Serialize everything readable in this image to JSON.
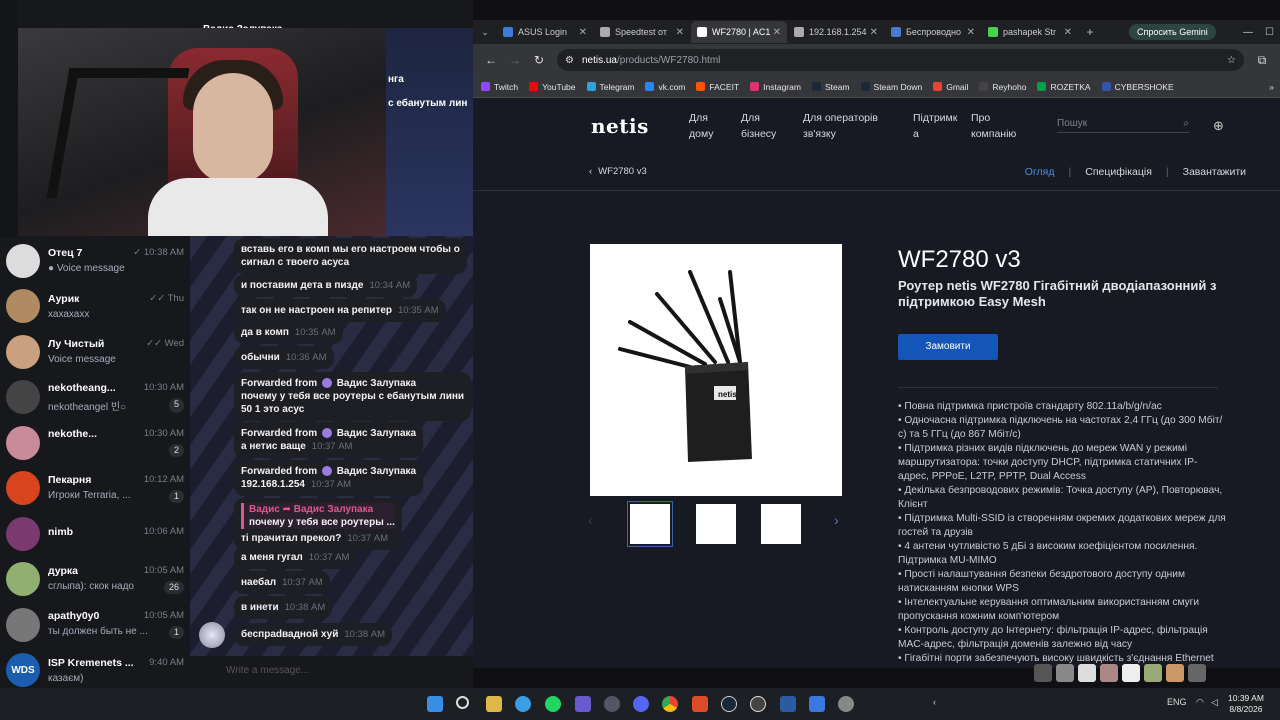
{
  "telegram": {
    "header_partial": "Вадис Залупака",
    "convo_top_lines": [
      "нга",
      "с ебанутым лин"
    ],
    "chats": [
      {
        "name": "Отец 7",
        "time": "10:38 AM",
        "preview": "● Voice message",
        "badge": "",
        "color": "#dcdcdc",
        "initial": "",
        "checks": "✓"
      },
      {
        "name": "Аурик",
        "time": "Thu",
        "preview": "хахахахх",
        "badge": "",
        "color": "#b08a60",
        "initial": "",
        "checks": "✓✓"
      },
      {
        "name": "Лу Чистый",
        "time": "Wed",
        "preview": "Voice message",
        "badge": "",
        "color": "#c9a080",
        "initial": "",
        "checks": "✓✓"
      },
      {
        "name": "nekotheang...",
        "time": "10:30 AM",
        "preview": "nekotheangel 빈○",
        "badge": "5",
        "color": "#444",
        "initial": "",
        "checks": ""
      },
      {
        "name": "nekothe...",
        "time": "10:30 AM",
        "preview": "",
        "badge": "2",
        "color": "#c98a9a",
        "initial": "",
        "checks": ""
      },
      {
        "name": "Пекарня",
        "time": "10:12 AM",
        "preview": "Игроки Terraria, ...",
        "badge": "1",
        "color": "#d8441e",
        "initial": "",
        "checks": ""
      },
      {
        "name": "nimb",
        "time": "10:06 AM",
        "preview": "",
        "badge": "",
        "color": "#7a3a70",
        "initial": "",
        "checks": ""
      },
      {
        "name": "дурка",
        "time": "10:05 AM",
        "preview": "сглыпа): скок надо",
        "badge": "26",
        "color": "#8fb070",
        "initial": "",
        "checks": ""
      },
      {
        "name": "apathy0y0",
        "time": "10:05 AM",
        "preview": "ты должен быть не ...",
        "badge": "1",
        "color": "#777",
        "initial": "",
        "checks": ""
      },
      {
        "name": "ISP Kremenets ...",
        "time": "9:40 AM",
        "preview": "казаєм)",
        "badge": "",
        "color": "#1b5eb0",
        "initial": "WDS",
        "checks": ""
      }
    ],
    "messages": [
      {
        "text": "вставь его в комп мы его настроем чтобы о",
        "text2": "сигнал с твоего асуса",
        "time": ""
      },
      {
        "text": "и поставим дета в пизде",
        "time": "10:34 AM"
      },
      {
        "text": "так он не настроен на репитер",
        "time": "10:35 AM"
      },
      {
        "text": "да в комп",
        "time": "10:35 AM"
      },
      {
        "text": "обычни",
        "time": "10:36 AM"
      },
      {
        "fwd": "Forwarded from",
        "from": "Вадис Залупака",
        "text": "почему у тебя все роутеры с ебанутым лини",
        "text2": "50 1 это асус",
        "time": ""
      },
      {
        "fwd": "Forwarded from",
        "from": "Вадис Залупака",
        "text": "а нетис ваще",
        "time": "10:37 AM"
      },
      {
        "fwd": "Forwarded from",
        "from": "Вадис Залупака",
        "text": "192.168.1.254",
        "time": "10:37 AM"
      },
      {
        "reply_who": "Вадис ➦ Вадис Залупака",
        "reply_text": "почему у тебя все роутеры ...",
        "text": "ті прачитал прекол?",
        "time": "10:37 AM"
      },
      {
        "text": "а меня гугал",
        "time": "10:37 AM"
      },
      {
        "text": "наебал",
        "time": "10:37 AM"
      },
      {
        "text": "в инети",
        "time": "10:38 AM"
      },
      {
        "text": "беспраdвадной хуй",
        "time": "10:38 AM"
      }
    ],
    "input_placeholder": "Write a message..."
  },
  "browser": {
    "tabs": [
      {
        "label": "ASUS Login",
        "color": "#3b7bd9"
      },
      {
        "label": "Speedtest от",
        "color": "#aaaaaa"
      },
      {
        "label": "WF2780 | AC1",
        "color": "#ffffff"
      },
      {
        "label": "192.168.1.254",
        "color": "#aaaaaa"
      },
      {
        "label": "Беспроводно",
        "color": "#4a7bd0"
      },
      {
        "label": "pashapek Str",
        "color": "#4ad04a"
      }
    ],
    "gemini": "Спросить Gemini",
    "url_host": "netis.ua",
    "url_path": "/products/WF2780.html",
    "bookmarks": [
      {
        "label": "Twitch",
        "color": "#9146ff"
      },
      {
        "label": "YouTube",
        "color": "#ff0000"
      },
      {
        "label": "Telegram",
        "color": "#2aa3e0"
      },
      {
        "label": "vk.com",
        "color": "#2787f5"
      },
      {
        "label": "FACEIT",
        "color": "#ff5500"
      },
      {
        "label": "Instagram",
        "color": "#e1306c"
      },
      {
        "label": "Steam",
        "color": "#1b2838"
      },
      {
        "label": "Steam Down",
        "color": "#1b2838"
      },
      {
        "label": "Gmail",
        "color": "#ea4335"
      },
      {
        "label": "Reyhoho",
        "color": "#444444"
      },
      {
        "label": "ROZETKA",
        "color": "#00a046"
      },
      {
        "label": "CYBERSHOKE",
        "color": "#3355aa"
      }
    ]
  },
  "site": {
    "logo": "netis",
    "nav": [
      "Для дому",
      "Для бізнесу",
      "Для операторів зв'язку",
      "Підтримк а",
      "Про компанію"
    ],
    "search_placeholder": "Пошук",
    "breadcrumb": "WF2780 v3",
    "tabs": [
      "Огляд",
      "Специфікація",
      "Завантажити"
    ],
    "title": "WF2780 v3",
    "subtitle": "Роутер netis WF2780 Гігабітний дводіапазонний з підтримкою Easy Mesh",
    "order_button": "Замовити",
    "features": [
      "• Повна підтримка пристроїв стандарту 802.11a/b/g/n/ac",
      "• Одночасна підтримка підключень на частотах 2,4 ГГц (до 300 Мбіт/с) та 5 ГГц (до 867 Мбіт/с)",
      "• Підтримка різних видів підключень до мереж WAN у режимі маршрутизатора: точки доступу DHCP, підтримка статичних IP-адрес, PPPoE, L2TP, PPTP, Dual Access",
      "• Декілька безпроводових режимів: Точка доступу (AP), Повторювач, Клієнт",
      "• Підтримка Multi-SSID із створенням окремих додаткових мереж для гостей та друзів",
      "• 4 антени чутливістю 5 дБі з високим коефіцієнтом посилення. Підтримка MU-MIMO",
      "• Прості налаштування безпеки бездротового доступу одним натисканням кнопки WPS",
      "• Інтелектуальне керування оптимальним використанням смуги пропускання кожним комп'ютером",
      "• Контроль доступу до Інтернету: фільтрація IP-адрес, фільтрація MAC-адрес, фільтрація доменів залежно від часу",
      "• Гігабітні порти забезпечують високу швидкість з'єднання Ethernet"
    ]
  },
  "taskbar": {
    "lang": "ENG",
    "time": "10:39 AM",
    "date": "8/8/2026"
  }
}
